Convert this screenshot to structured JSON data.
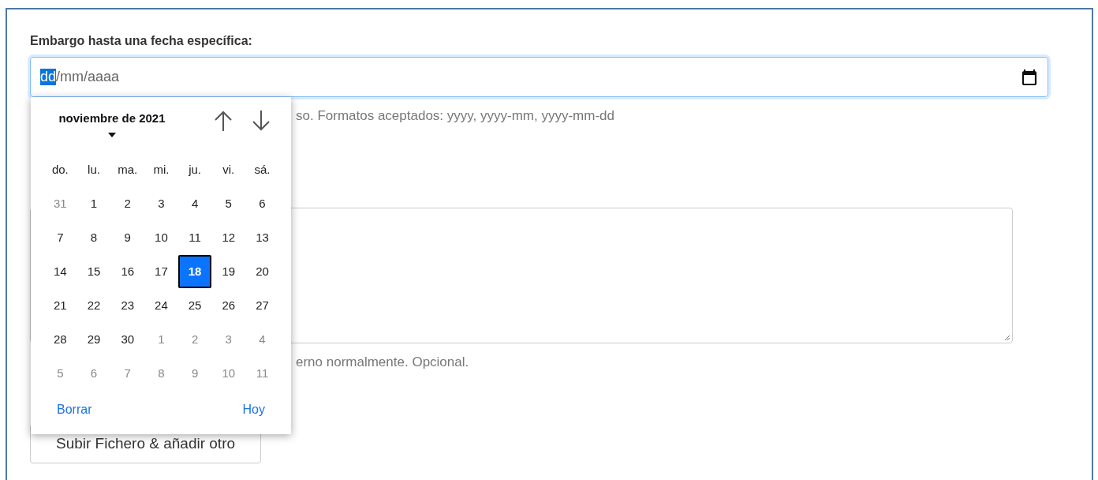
{
  "embargo_label": "Embargo hasta una fecha específica:",
  "date_field": {
    "segments": [
      {
        "text": "dd",
        "selected": true
      },
      {
        "text": "/mm/aaaa",
        "selected": false
      }
    ]
  },
  "date_help": "so. Formatos aceptados: yyyy, yyyy-mm, yyyy-mm-dd",
  "notes_help": "erno normalmente. Opcional.",
  "upload_button": "Subir Fichero & añadir otro",
  "calendar": {
    "month_title": "noviembre de 2021",
    "weekdays": [
      "do.",
      "lu.",
      "ma.",
      "mi.",
      "ju.",
      "vi.",
      "sá."
    ],
    "days": [
      {
        "label": "31",
        "outside": true,
        "selected": false
      },
      {
        "label": "1",
        "outside": false,
        "selected": false
      },
      {
        "label": "2",
        "outside": false,
        "selected": false
      },
      {
        "label": "3",
        "outside": false,
        "selected": false
      },
      {
        "label": "4",
        "outside": false,
        "selected": false
      },
      {
        "label": "5",
        "outside": false,
        "selected": false
      },
      {
        "label": "6",
        "outside": false,
        "selected": false
      },
      {
        "label": "7",
        "outside": false,
        "selected": false
      },
      {
        "label": "8",
        "outside": false,
        "selected": false
      },
      {
        "label": "9",
        "outside": false,
        "selected": false
      },
      {
        "label": "10",
        "outside": false,
        "selected": false
      },
      {
        "label": "11",
        "outside": false,
        "selected": false
      },
      {
        "label": "12",
        "outside": false,
        "selected": false
      },
      {
        "label": "13",
        "outside": false,
        "selected": false
      },
      {
        "label": "14",
        "outside": false,
        "selected": false
      },
      {
        "label": "15",
        "outside": false,
        "selected": false
      },
      {
        "label": "16",
        "outside": false,
        "selected": false
      },
      {
        "label": "17",
        "outside": false,
        "selected": false
      },
      {
        "label": "18",
        "outside": false,
        "selected": true
      },
      {
        "label": "19",
        "outside": false,
        "selected": false
      },
      {
        "label": "20",
        "outside": false,
        "selected": false
      },
      {
        "label": "21",
        "outside": false,
        "selected": false
      },
      {
        "label": "22",
        "outside": false,
        "selected": false
      },
      {
        "label": "23",
        "outside": false,
        "selected": false
      },
      {
        "label": "24",
        "outside": false,
        "selected": false
      },
      {
        "label": "25",
        "outside": false,
        "selected": false
      },
      {
        "label": "26",
        "outside": false,
        "selected": false
      },
      {
        "label": "27",
        "outside": false,
        "selected": false
      },
      {
        "label": "28",
        "outside": false,
        "selected": false
      },
      {
        "label": "29",
        "outside": false,
        "selected": false
      },
      {
        "label": "30",
        "outside": false,
        "selected": false
      },
      {
        "label": "1",
        "outside": true,
        "selected": false
      },
      {
        "label": "2",
        "outside": true,
        "selected": false
      },
      {
        "label": "3",
        "outside": true,
        "selected": false
      },
      {
        "label": "4",
        "outside": true,
        "selected": false
      },
      {
        "label": "5",
        "outside": true,
        "selected": false
      },
      {
        "label": "6",
        "outside": true,
        "selected": false
      },
      {
        "label": "7",
        "outside": true,
        "selected": false
      },
      {
        "label": "8",
        "outside": true,
        "selected": false
      },
      {
        "label": "9",
        "outside": true,
        "selected": false
      },
      {
        "label": "10",
        "outside": true,
        "selected": false
      },
      {
        "label": "11",
        "outside": true,
        "selected": false
      }
    ],
    "clear_link": "Borrar",
    "today_link": "Hoy"
  }
}
